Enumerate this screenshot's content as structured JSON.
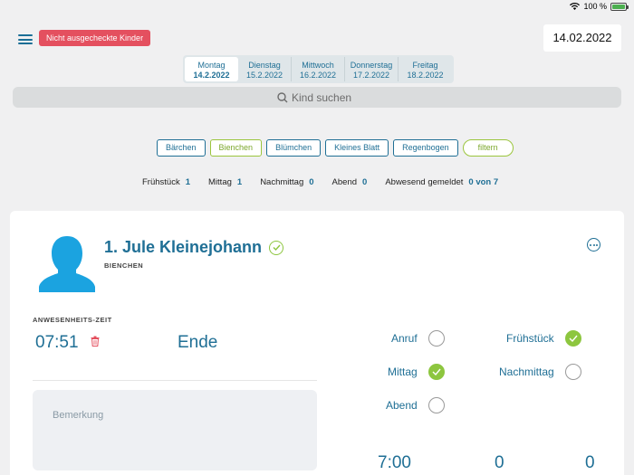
{
  "status_bar": {
    "battery": "100 %"
  },
  "header": {
    "alert_button": "Nicht ausgecheckte Kinder",
    "date": "14.02.2022"
  },
  "days": [
    {
      "name": "Montag",
      "date": "14.2.2022"
    },
    {
      "name": "Dienstag",
      "date": "15.2.2022"
    },
    {
      "name": "Mittwoch",
      "date": "16.2.2022"
    },
    {
      "name": "Donnerstag",
      "date": "17.2.2022"
    },
    {
      "name": "Freitag",
      "date": "18.2.2022"
    }
  ],
  "search": {
    "placeholder": "Kind suchen"
  },
  "groups": [
    "Bärchen",
    "Bienchen",
    "Blümchen",
    "Kleines Blatt",
    "Regenbogen"
  ],
  "filter_label": "filtern",
  "stats": [
    {
      "label": "Frühstück",
      "value": "1"
    },
    {
      "label": "Mittag",
      "value": "1"
    },
    {
      "label": "Nachmittag",
      "value": "0"
    },
    {
      "label": "Abend",
      "value": "0"
    },
    {
      "label": "Abwesend gemeldet",
      "value": "0 von 7"
    }
  ],
  "child": {
    "name": "1. Jule Kleinejohann",
    "group": "BIENCHEN",
    "attendance_label": "ANWESENHEITS-ZEIT",
    "start_time": "07:51",
    "end_label": "Ende",
    "remark_placeholder": "Bemerkung",
    "checks": [
      {
        "label": "Anruf",
        "checked": false
      },
      {
        "label": "Frühstück",
        "checked": true
      },
      {
        "label": "Mittag",
        "checked": true
      },
      {
        "label": "Nachmittag",
        "checked": false
      },
      {
        "label": "Abend",
        "checked": false
      }
    ],
    "bottom_values": [
      "7:00",
      "0",
      "0"
    ]
  },
  "colors": {
    "accent": "#1f6f95",
    "green": "#8dc63f",
    "alert": "#e4505f"
  }
}
